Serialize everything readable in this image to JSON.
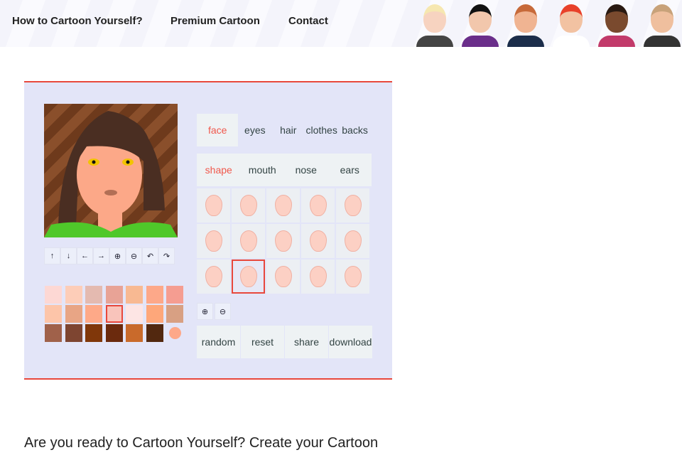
{
  "nav": [
    "How to Cartoon Yourself?",
    "Premium Cartoon",
    "Contact"
  ],
  "avatars": [
    {
      "hair": "#f6e7b0",
      "skin": "#f7d3c0",
      "shirt": "#444"
    },
    {
      "hair": "#111",
      "skin": "#f2c7ac",
      "shirt": "#6a2e8a"
    },
    {
      "hair": "#c76a3a",
      "skin": "#f0b492",
      "shirt": "#1b2d4a"
    },
    {
      "hair": "#e8412a",
      "skin": "#f2c2a2",
      "shirt": "#fff"
    },
    {
      "hair": "#2a1a12",
      "skin": "#7a4a2e",
      "shirt": "#c23a6a"
    },
    {
      "hair": "#c8a27a",
      "skin": "#efbf9e",
      "shirt": "#333"
    }
  ],
  "tools": [
    {
      "icon": "arrow-up-icon",
      "g": "↑"
    },
    {
      "icon": "arrow-down-icon",
      "g": "↓"
    },
    {
      "icon": "arrow-left-icon",
      "g": "←"
    },
    {
      "icon": "arrow-right-icon",
      "g": "→"
    },
    {
      "icon": "zoom-in-icon",
      "g": "⊕"
    },
    {
      "icon": "zoom-out-icon",
      "g": "⊖"
    },
    {
      "icon": "undo-icon",
      "g": "↶"
    },
    {
      "icon": "redo-icon",
      "g": "↷"
    }
  ],
  "skin_colors": [
    "#fdd8d4",
    "#fdcdb8",
    "#e4bab0",
    "#e8a396",
    "#f8b992",
    "#fda889",
    "#f59d91",
    "#fdc5a9",
    "#e8a585",
    "#fea988",
    "#f9c4bb",
    "#fde5e4",
    "#fea77a",
    "#d8a083",
    "#a0614a",
    "#7e4531",
    "#80370a",
    "#6b2a0d",
    "#c96a2b",
    "#52280f",
    "#fda889"
  ],
  "selected_color": 10,
  "tabs": [
    "face",
    "eyes",
    "hair",
    "clothes",
    "backs"
  ],
  "active_tab": 0,
  "subtabs": [
    "shape",
    "mouth",
    "nose",
    "ears"
  ],
  "active_subtab": 0,
  "selected_shape": 11,
  "actions": [
    "random",
    "reset",
    "share",
    "download"
  ],
  "accent": "#e8483c",
  "heading": "Are you ready to Cartoon Yourself? Create your Cartoon"
}
